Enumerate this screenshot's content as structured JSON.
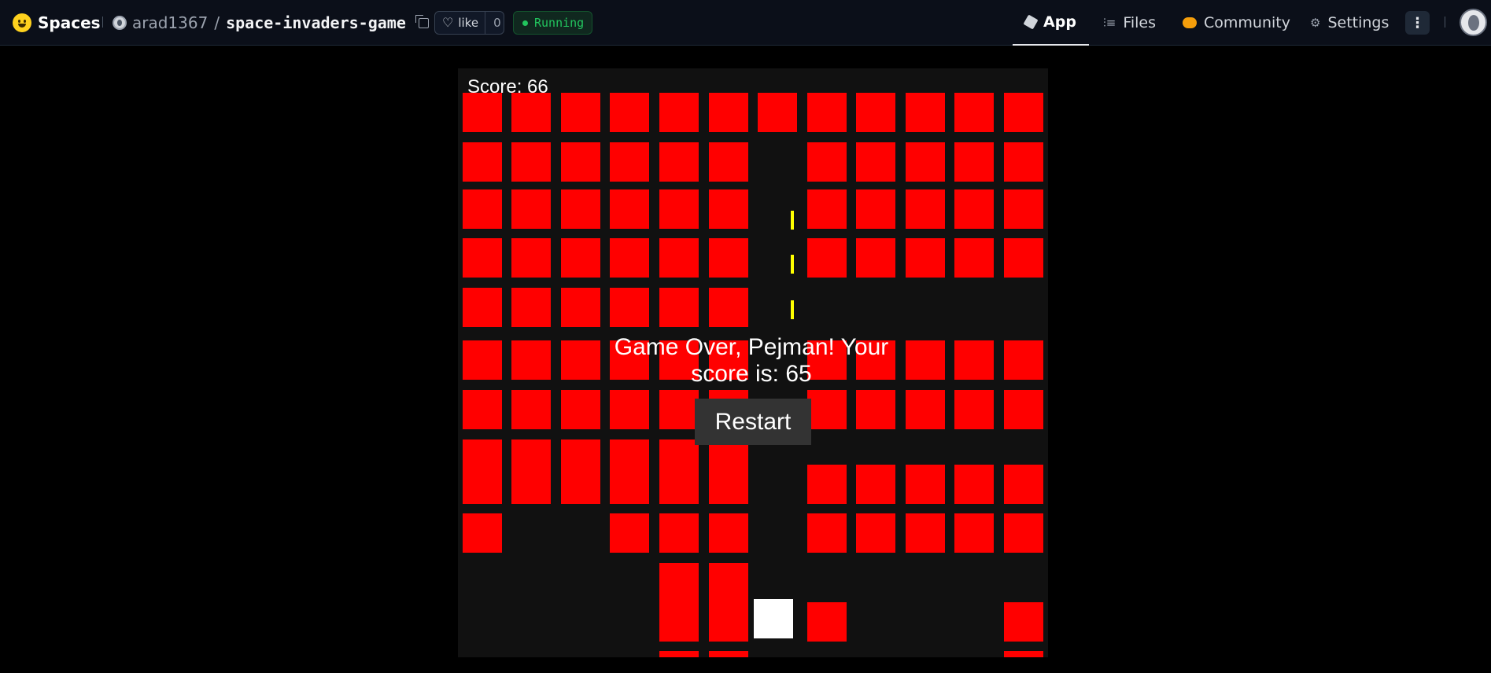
{
  "header": {
    "brand": "Spaces",
    "owner": "arad1367",
    "separator": "/",
    "repo": "space-invaders-game",
    "like_label": "like",
    "like_count": "0",
    "status": "Running",
    "nav": {
      "app": "App",
      "files": "Files",
      "community": "Community",
      "settings": "Settings"
    },
    "more_label": "⋮"
  },
  "game": {
    "score_label": "Score: 66",
    "game_over_message": "Game Over, Pejman! Your score is: 65",
    "restart_label": "Restart"
  },
  "colors": {
    "alien": "#ff0000",
    "bullet": "#ffff00",
    "player": "#ffffff",
    "game_background": "#111111",
    "status_green": "#22c55e"
  }
}
